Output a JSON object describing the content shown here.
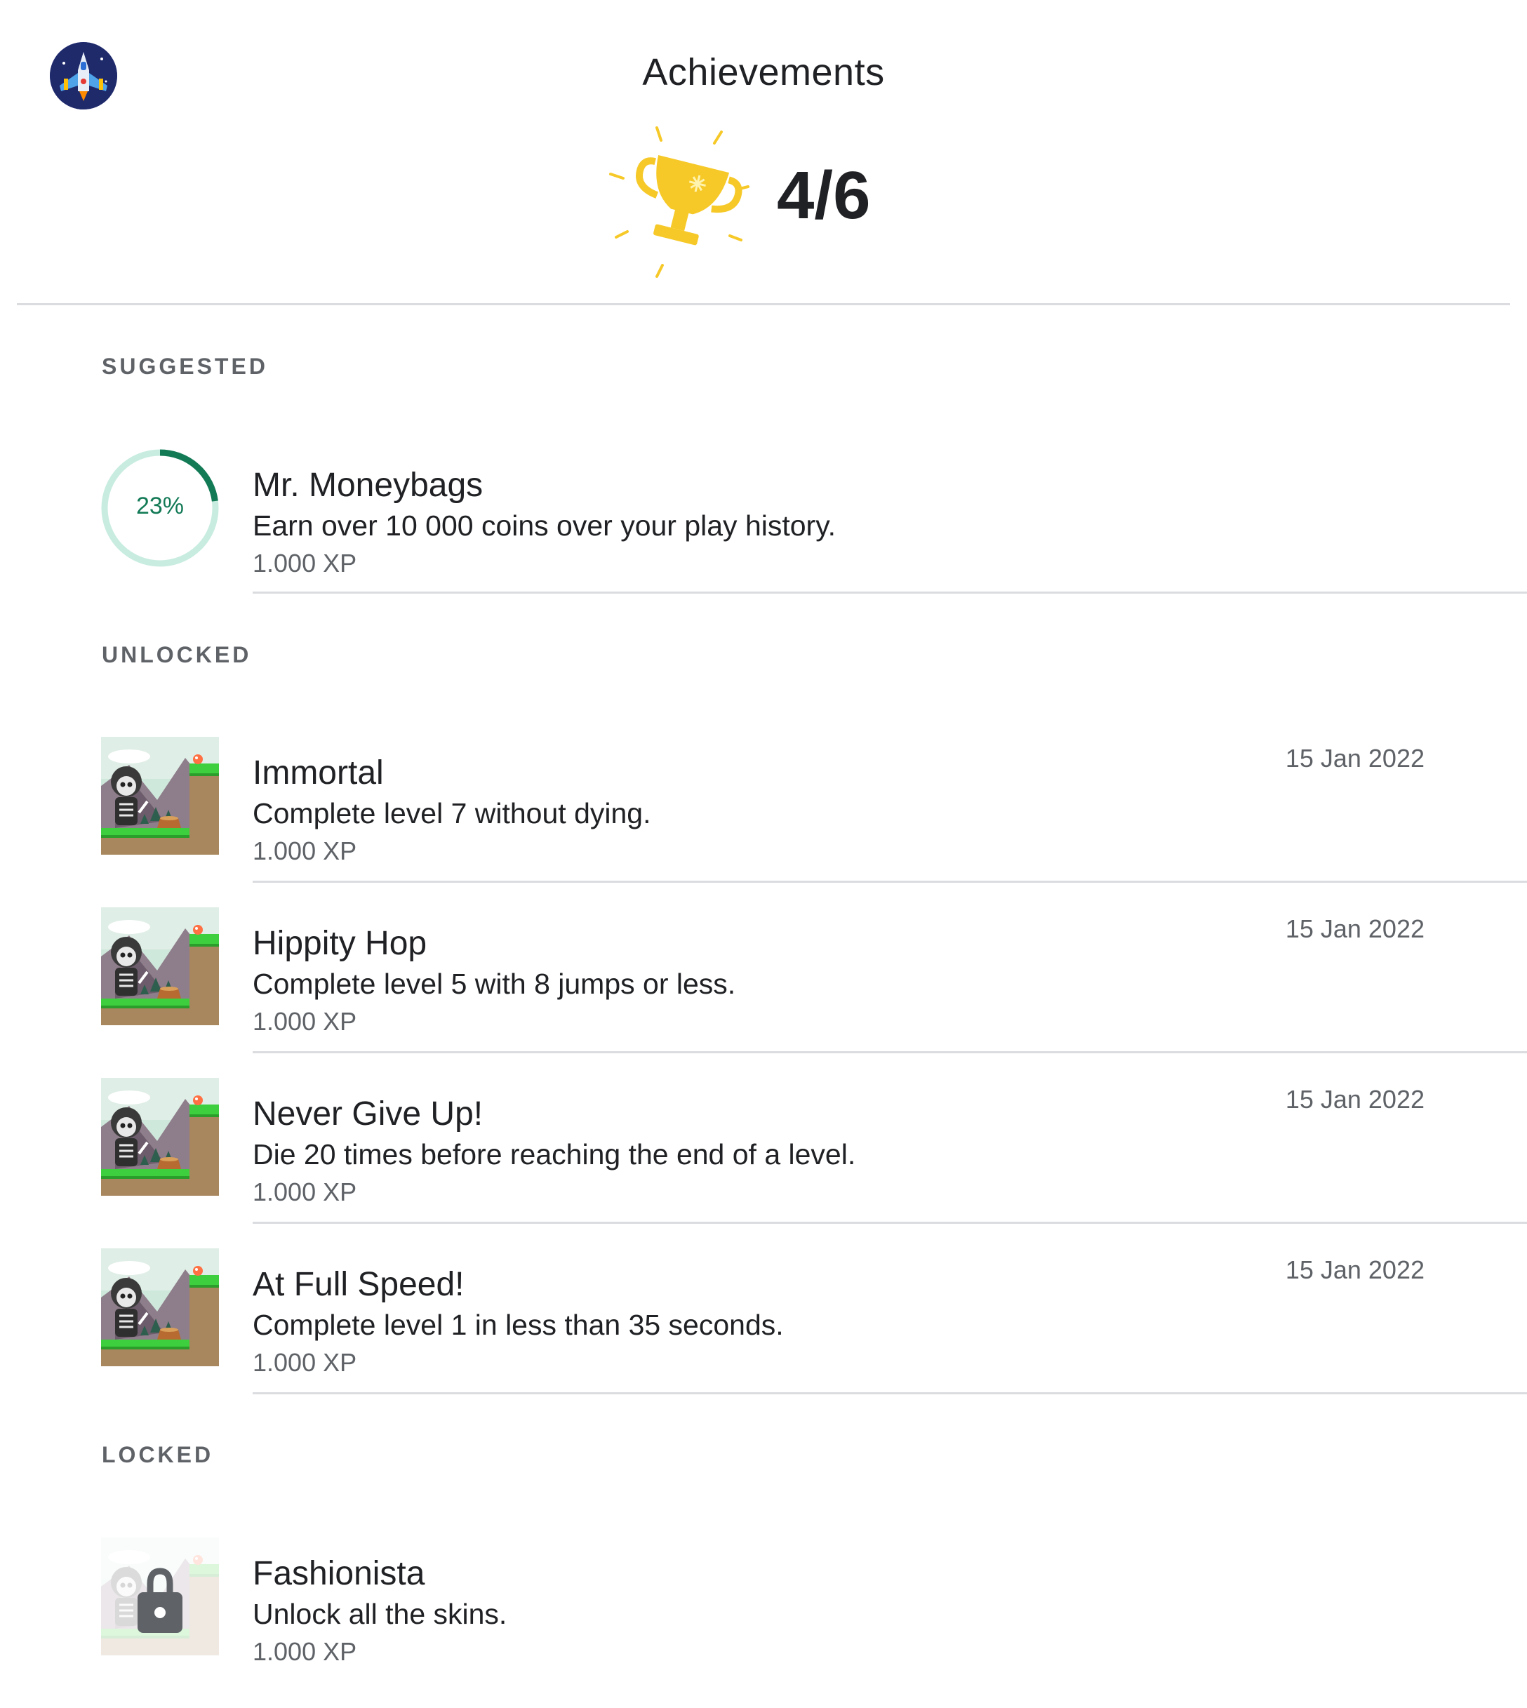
{
  "header": {
    "title": "Achievements",
    "score": "4/6",
    "avatar_icon": "spaceship-game-icon",
    "trophy_icon": "gold-trophy-icon"
  },
  "sections": {
    "suggested": "SUGGESTED",
    "unlocked": "UNLOCKED",
    "locked": "LOCKED"
  },
  "suggested": [
    {
      "title": "Mr. Moneybags",
      "description": "Earn over 10 000 coins over your play history.",
      "xp": "1.000 XP",
      "progress_label": "23%",
      "progress": 0.23
    }
  ],
  "unlocked": [
    {
      "title": "Immortal",
      "description": "Complete level 7 without dying.",
      "xp": "1.000 XP",
      "date": "15 Jan 2022"
    },
    {
      "title": "Hippity Hop",
      "description": "Complete level 5 with 8 jumps or less.",
      "xp": "1.000 XP",
      "date": "15 Jan 2022"
    },
    {
      "title": "Never Give Up!",
      "description": "Die 20 times before reaching the end of a level.",
      "xp": "1.000 XP",
      "date": "15 Jan 2022"
    },
    {
      "title": "At Full Speed!",
      "description": "Complete level 1 in less than 35 seconds.",
      "xp": "1.000 XP",
      "date": "15 Jan 2022"
    }
  ],
  "locked": [
    {
      "title": "Fashionista",
      "description": "Unlock all the skins.",
      "xp": "1.000 XP"
    }
  ],
  "colors": {
    "accent_green": "#137a56",
    "ring_track": "#c8ece0",
    "trophy_gold": "#f6c928",
    "divider": "#dadce0"
  }
}
